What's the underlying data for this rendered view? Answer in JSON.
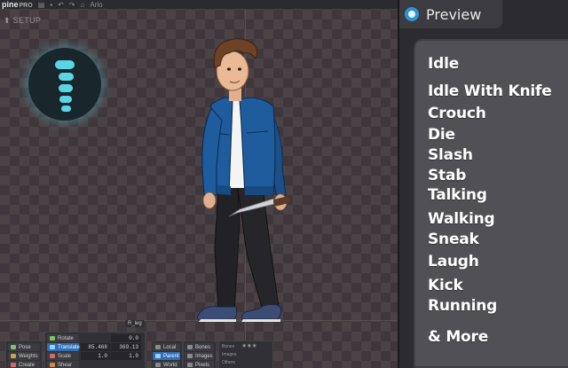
{
  "app": {
    "logo_main": "pine",
    "logo_suffix": "PRO",
    "toolbar_label": "Arlo",
    "mode_label": "SETUP"
  },
  "viewport": {
    "bone_label": "R_leg"
  },
  "tools": {
    "left": [
      "Pose",
      "Weights",
      "Create"
    ],
    "transform": [
      {
        "label": "Rotate",
        "v1": "0.0",
        "v2": ""
      },
      {
        "label": "Translate",
        "v1": "85.468",
        "v2": "369.13"
      },
      {
        "label": "Scale",
        "v1": "1.0",
        "v2": "1.0"
      },
      {
        "label": "Shear",
        "v1": "",
        "v2": ""
      }
    ],
    "axes": [
      "Local",
      "Parent",
      "World"
    ],
    "compensate": [
      "Bones",
      "Images",
      "Pixels"
    ],
    "options": [
      "Bones",
      "Images",
      "Others"
    ]
  },
  "preview": {
    "title": "Preview",
    "animations": [
      "Idle",
      "Idle With Knife",
      "Crouch",
      "Die",
      "Slash",
      "Stab",
      "Talking",
      "Walking",
      "Sneak",
      "Laugh",
      "Kick",
      "Running",
      "& More"
    ]
  },
  "colors": {
    "accent": "#2f6fb3",
    "badge_glow": "#58d6e6",
    "jacket": "#1f5c9e"
  }
}
